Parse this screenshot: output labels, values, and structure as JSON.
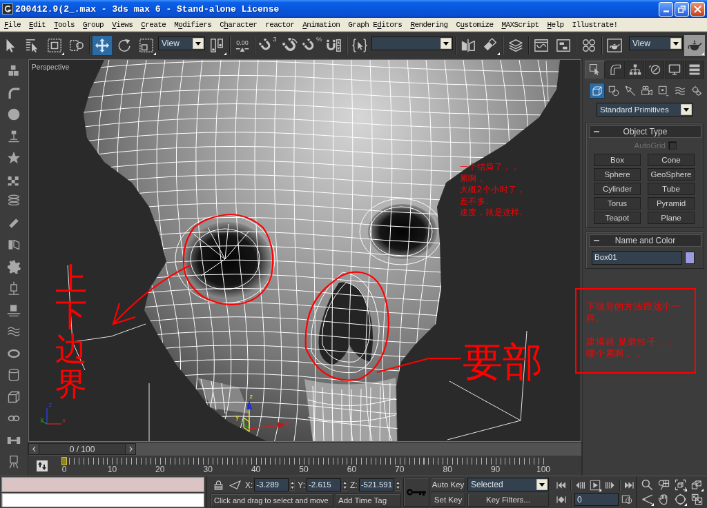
{
  "window": {
    "title": "200412.9(2_.max - 3ds max 6 - Stand-alone License"
  },
  "menu_bar": {
    "items": [
      {
        "parts": [
          {
            "text": "F",
            "underlined": true
          },
          {
            "text": "ile",
            "underlined": false
          }
        ]
      },
      {
        "parts": [
          {
            "text": "E",
            "underlined": true
          },
          {
            "text": "dit",
            "underlined": false
          }
        ]
      },
      {
        "parts": [
          {
            "text": "T",
            "underlined": true
          },
          {
            "text": "ools",
            "underlined": false
          }
        ]
      },
      {
        "parts": [
          {
            "text": "G",
            "underlined": true
          },
          {
            "text": "roup",
            "underlined": false
          }
        ]
      },
      {
        "parts": [
          {
            "text": "V",
            "underlined": true
          },
          {
            "text": "iews",
            "underlined": false
          }
        ]
      },
      {
        "parts": [
          {
            "text": "C",
            "underlined": true
          },
          {
            "text": "reate",
            "underlined": false
          }
        ]
      },
      {
        "parts": [
          {
            "text": "M",
            "underlined": false
          },
          {
            "text": "o",
            "underlined": true
          },
          {
            "text": "difiers",
            "underlined": false
          }
        ]
      },
      {
        "parts": [
          {
            "text": "C",
            "underlined": false
          },
          {
            "text": "h",
            "underlined": true
          },
          {
            "text": "aracter",
            "underlined": false
          }
        ]
      },
      {
        "parts": [
          {
            "text": "reactor",
            "underlined": false
          }
        ]
      },
      {
        "parts": [
          {
            "text": "A",
            "underlined": true
          },
          {
            "text": "nimation",
            "underlined": false
          }
        ]
      },
      {
        "parts": [
          {
            "text": "Graph E",
            "underlined": false
          },
          {
            "text": "d",
            "underlined": true
          },
          {
            "text": "itors",
            "underlined": false
          }
        ]
      },
      {
        "parts": [
          {
            "text": "R",
            "underlined": true
          },
          {
            "text": "endering",
            "underlined": false
          }
        ]
      },
      {
        "parts": [
          {
            "text": "C",
            "underlined": false
          },
          {
            "text": "u",
            "underlined": true
          },
          {
            "text": "stomize",
            "underlined": false
          }
        ]
      },
      {
        "parts": [
          {
            "text": "M",
            "underlined": true
          },
          {
            "text": "AXScript",
            "underlined": false
          }
        ]
      },
      {
        "parts": [
          {
            "text": "H",
            "underlined": true
          },
          {
            "text": "elp",
            "underlined": false
          }
        ]
      },
      {
        "parts": [
          {
            "text": "Illustrate!",
            "underlined": false
          }
        ]
      }
    ]
  },
  "main_toolbar": {
    "items": [
      {
        "kind": "button",
        "selected": false,
        "flyout": false
      },
      {
        "kind": "button",
        "selected": false,
        "flyout": false
      },
      {
        "kind": "button",
        "selected": false,
        "flyout": true
      },
      {
        "kind": "button",
        "selected": false,
        "flyout": false
      },
      {
        "kind": "button",
        "selected": true,
        "flyout": false
      },
      {
        "kind": "button",
        "selected": false,
        "flyout": false
      },
      {
        "kind": "button",
        "selected": false,
        "flyout": true
      },
      {
        "kind": "dropdown",
        "value": "View"
      },
      {
        "kind": "button",
        "selected": false,
        "flyout": true
      },
      {
        "kind": "button",
        "selected": false,
        "flyout": false,
        "label": "0.00"
      },
      {
        "kind": "button",
        "selected": false,
        "flyout": false,
        "label": "3"
      },
      {
        "kind": "button",
        "selected": false,
        "flyout": false
      },
      {
        "kind": "button",
        "selected": false,
        "flyout": false,
        "label": "%"
      },
      {
        "kind": "button",
        "selected": false,
        "flyout": false
      },
      {
        "kind": "button",
        "selected": false,
        "flyout": false
      },
      {
        "kind": "dropdown"
      },
      {
        "kind": "button",
        "selected": false,
        "flyout": false
      },
      {
        "kind": "button",
        "selected": false,
        "flyout": true
      },
      {
        "kind": "button",
        "selected": false,
        "flyout": false
      },
      {
        "kind": "button",
        "selected": false,
        "flyout": false
      },
      {
        "kind": "button",
        "selected": false,
        "flyout": false
      },
      {
        "kind": "button",
        "selected": false,
        "flyout": false
      },
      {
        "kind": "button",
        "selected": false,
        "flyout": false
      },
      {
        "kind": "dropdown",
        "value": "View"
      },
      {
        "kind": "button",
        "selected": false,
        "flyout": true
      }
    ]
  },
  "command_panel": {
    "tabs": [
      {
        "selected": true
      },
      {
        "selected": false
      },
      {
        "selected": false
      },
      {
        "selected": false
      },
      {
        "selected": false
      },
      {
        "selected": false
      }
    ],
    "categories": [
      {
        "selected": true
      },
      {
        "selected": false
      },
      {
        "selected": false
      },
      {
        "selected": false
      },
      {
        "selected": false
      },
      {
        "selected": false
      },
      {
        "selected": false
      }
    ],
    "type_dropdown": {
      "value": "Standard Primitives"
    },
    "object_type": {
      "title": "Object Type",
      "expanded": true,
      "autogrid": {
        "label": "AutoGrid",
        "checked": false,
        "disabled": true
      },
      "buttons": [
        {
          "label": "Box",
          "selected": false
        },
        {
          "label": "Cone",
          "selected": false
        },
        {
          "label": "Sphere",
          "selected": false
        },
        {
          "label": "GeoSphere",
          "selected": false
        },
        {
          "label": "Cylinder",
          "selected": false
        },
        {
          "label": "Tube",
          "selected": false
        },
        {
          "label": "Torus",
          "selected": false
        },
        {
          "label": "Pyramid",
          "selected": false
        },
        {
          "label": "Teapot",
          "selected": false
        },
        {
          "label": "Plane",
          "selected": false
        }
      ]
    },
    "name_and_color": {
      "title": "Name and Color",
      "expanded": true,
      "name": "Box01",
      "color": "#9c9ae0"
    }
  },
  "viewport": {
    "label": "Perspective",
    "axis_tripod": {
      "labels": [
        "z",
        "y",
        "x"
      ]
    },
    "move_gizmo": {
      "labels": [
        "z",
        "y",
        "x"
      ]
    },
    "handwriting": [
      {
        "kind": "vertical",
        "text": "上下边界"
      },
      {
        "kind": "horizontal",
        "text": "要部"
      }
    ],
    "note": {
      "lines": [
        "一个结局了，，",
        "累啊，",
        "大概2个小时了，",
        "差不多.",
        "速度，就是这样."
      ]
    },
    "boxed_note": {
      "paragraphs": [
        {
          "lines": [
            "下颌骨的方法跟这个一样."
          ]
        },
        {
          "lines": [
            "建摸就 是磨性子，，",
            "哪个累啊，，"
          ]
        }
      ]
    }
  },
  "time_slider": {
    "label": "0 / 100",
    "level": 0
  },
  "track_bar": {
    "labels": [
      "0",
      "10",
      "20",
      "30",
      "40",
      "50",
      "60",
      "70",
      "80",
      "90",
      "100"
    ],
    "level": 0
  },
  "status": {
    "coordinates": [
      {
        "label": "X:",
        "value": "-3.289"
      },
      {
        "label": "Y:",
        "value": "-2.615"
      },
      {
        "label": "Z:",
        "value": "-521.591"
      }
    ],
    "prompt": "Click and drag to select and move",
    "add_time_tag": "Add Time Tag"
  },
  "animation_controls": {
    "auto_key": {
      "label": "Auto Key",
      "on": false
    },
    "set_key": {
      "label": "Set Key"
    },
    "key_mode": {
      "value": "Selected"
    },
    "key_filters": {
      "label": "Key Filters..."
    },
    "current_frame": {
      "value": "0"
    }
  }
}
